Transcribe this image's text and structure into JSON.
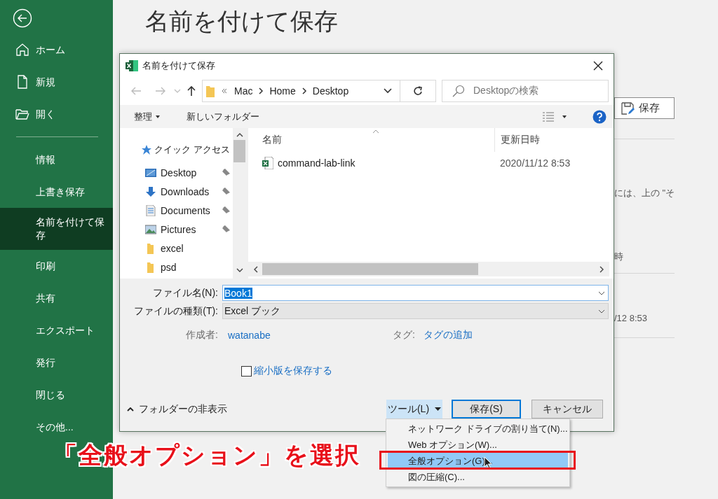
{
  "sidebar": {
    "top_items": [
      {
        "label": "ホーム",
        "selected": false
      },
      {
        "label": "新規",
        "selected": false
      },
      {
        "label": "開く",
        "selected": false
      }
    ],
    "items": [
      {
        "label": "情報",
        "selected": false
      },
      {
        "label": "上書き保存",
        "selected": false
      },
      {
        "label": "名前を付けて保存",
        "selected": true
      },
      {
        "label": "印刷",
        "selected": false
      },
      {
        "label": "共有",
        "selected": false
      },
      {
        "label": "エクスポート",
        "selected": false
      },
      {
        "label": "発行",
        "selected": false
      },
      {
        "label": "閉じる",
        "selected": false
      },
      {
        "label": "その他...",
        "selected": false
      }
    ]
  },
  "page_title": "名前を付けて保存",
  "right_pane": {
    "save_button": "保存",
    "texts": [
      "には、上の \"そ",
      "時",
      "/12 8:53"
    ]
  },
  "dialog": {
    "title": "名前を付けて保存",
    "address": {
      "path": [
        "Mac",
        "Home",
        "Desktop"
      ]
    },
    "search": {
      "placeholder": "Desktopの検索"
    },
    "toolbar": {
      "organize": "整理",
      "new_folder": "新しいフォルダー"
    },
    "nav_pane": {
      "quick_access": "クイック アクセス",
      "items": [
        {
          "label": "Desktop",
          "pinned": true
        },
        {
          "label": "Downloads",
          "pinned": true
        },
        {
          "label": "Documents",
          "pinned": true
        },
        {
          "label": "Pictures",
          "pinned": true
        },
        {
          "label": "excel",
          "pinned": false
        },
        {
          "label": "psd",
          "pinned": false
        }
      ]
    },
    "file_list": {
      "columns": [
        "名前",
        "更新日時"
      ],
      "rows": [
        {
          "name": "command-lab-link",
          "modified": "2020/11/12 8:53",
          "selected": false
        }
      ]
    },
    "file_name": {
      "label": "ファイル名(N):",
      "value": "Book1",
      "value_selected": true
    },
    "file_type": {
      "label": "ファイルの種類(T):",
      "value": "Excel ブック"
    },
    "author": {
      "label": "作成者:",
      "value": "watanabe"
    },
    "tags": {
      "label": "タグ:",
      "value": "タグの追加"
    },
    "thumbnail": {
      "label": "縮小版を保存する",
      "checked": false
    },
    "hide_folders": "フォルダーの非表示",
    "buttons": {
      "tools": "ツール(L)",
      "save": "保存(S)",
      "cancel": "キャンセル"
    },
    "tools_open": true,
    "tools_menu": [
      {
        "label": "ネットワーク ドライブの割り当て(N)...",
        "selected": false
      },
      {
        "label": "Web オプション(W)...",
        "selected": false
      },
      {
        "label": "全般オプション(G)...",
        "selected": true
      },
      {
        "label": "図の圧縮(C)...",
        "selected": false
      }
    ]
  },
  "annotation": "「全般オプション」を選択"
}
